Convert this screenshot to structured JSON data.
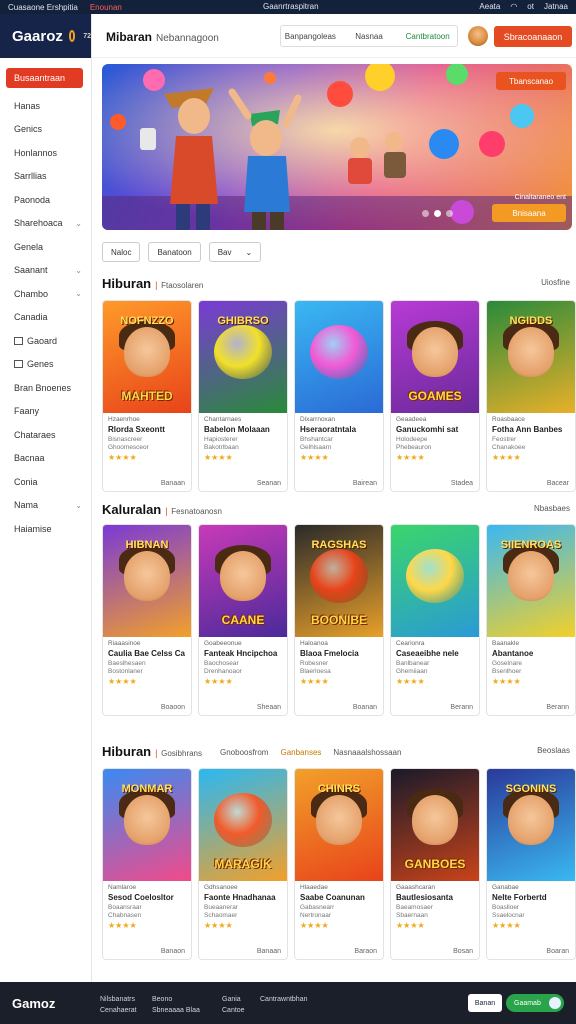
{
  "status_bar": {
    "left_1": "Cuasaone Ershpitia",
    "left_2": "Enounan",
    "center": "Gaanrtraspitran",
    "right_1": "Aeata",
    "right_2": "ot",
    "right_3": "Jatnaa"
  },
  "sidebar": {
    "logo": "Gaaroz",
    "logo_sup": "72",
    "cta": "Busaantraan",
    "items": [
      {
        "label": "Hanas",
        "chevron": false,
        "icon": false
      },
      {
        "label": "Genics",
        "chevron": false,
        "icon": false
      },
      {
        "label": "Honlannos",
        "chevron": false,
        "icon": false
      },
      {
        "label": "Sarrllias",
        "chevron": false,
        "icon": false
      },
      {
        "label": "Paonoda",
        "chevron": false,
        "icon": false
      },
      {
        "label": "Sharehoaca",
        "chevron": true,
        "icon": false
      },
      {
        "label": "Genela",
        "chevron": false,
        "icon": false
      },
      {
        "label": "Saanant",
        "chevron": true,
        "icon": false
      },
      {
        "label": "Chambo",
        "chevron": true,
        "icon": false
      },
      {
        "label": "Canadia",
        "chevron": false,
        "icon": false
      },
      {
        "label": "Gaoard",
        "chevron": false,
        "icon": true
      },
      {
        "label": "Genes",
        "chevron": false,
        "icon": true
      },
      {
        "label": "Bran Bnoenes",
        "chevron": false,
        "icon": false
      },
      {
        "label": "Faany",
        "chevron": false,
        "icon": false
      },
      {
        "label": "Chataraes",
        "chevron": false,
        "icon": false
      },
      {
        "label": "Bacnaa",
        "chevron": false,
        "icon": false
      },
      {
        "label": "Conia",
        "chevron": false,
        "icon": false
      },
      {
        "label": "Nama",
        "chevron": true,
        "icon": false
      },
      {
        "label": "Haiamise",
        "chevron": false,
        "icon": false
      }
    ]
  },
  "header": {
    "title": "Mibaran",
    "subtitle": "Nebannagoon",
    "tabs": [
      "Banpangoleas",
      "Nasnaa",
      "Cantbratoon"
    ],
    "active_tab_index": 2,
    "cta": "Sbracoanaaon"
  },
  "hero": {
    "cta": "Tbanscanao",
    "caption": "Cinaltaraneo ent",
    "button": "Bnisaana"
  },
  "filters": [
    "Naloc",
    "Banatoon",
    "Bav"
  ],
  "sections": [
    {
      "title": "Hiburan",
      "subtitle": "Ftaosolaren",
      "link": "Uiosfine",
      "tabs": [],
      "cards": [
        {
          "thumb_text": "MAHTED",
          "thumb_top": "NOFNZZO",
          "l1": "Hzaenrhoe",
          "l2": "Rlorda Sxeontt",
          "l3": "Bisnascreer",
          "l4": "Ghoomesceor",
          "stars": "★★★★",
          "more": "Banaan"
        },
        {
          "thumb_text": "",
          "thumb_top": "GHIBRSO",
          "l1": "Chantarnaes",
          "l2": "Babelon Molaaan",
          "l3": "Hapiosterer",
          "l4": "Bakotrlbaan",
          "stars": "★★★★",
          "more": "Seanan"
        },
        {
          "thumb_text": "",
          "thumb_top": "",
          "l1": "Dixarrnoxan",
          "l2": "Hseraoratntala",
          "l3": "Bhshantcar",
          "l4": "Gelhlsaarn",
          "stars": "★★★★",
          "more": "Bairean"
        },
        {
          "thumb_text": "GOAMES",
          "thumb_top": "",
          "l1": "Geaadeea",
          "l2": "Ganuckomhi sat",
          "l3": "Holodeepe",
          "l4": "Phebeauron",
          "stars": "★★★★",
          "more": "Stadea"
        },
        {
          "thumb_text": "",
          "thumb_top": "NGIDDS",
          "l1": "Roasbaace",
          "l2": "Fotha Ann Banbes",
          "l3": "Feostrer",
          "l4": "Chanakoee",
          "stars": "★★★★",
          "more": "Bacear"
        }
      ]
    },
    {
      "title": "Kaluralan",
      "subtitle": "Fesnatoanosn",
      "link": "Nbasbaes",
      "tabs": [],
      "cards": [
        {
          "thumb_text": "",
          "thumb_top": "HIBNAN",
          "l1": "Riaaasinoe",
          "l2": "Caulia Bae Celss Ca",
          "l3": "Baeslhesaen",
          "l4": "Bostonlaner",
          "stars": "★★★★",
          "more": "Boaoon"
        },
        {
          "thumb_text": "CAANE",
          "thumb_top": "",
          "l1": "Goabeeonue",
          "l2": "Fanteak Hncipchoa",
          "l3": "Baochosear",
          "l4": "Drenhanoaor",
          "stars": "★★★★",
          "more": "Sheaan"
        },
        {
          "thumb_text": "BOONIBE",
          "thumb_top": "RAGSHAS",
          "l1": "Haloanoa",
          "l2": "Blaoa Fmelocia",
          "l3": "Robesner",
          "l4": "Blaerloesa",
          "stars": "★★★★",
          "more": "Boanan"
        },
        {
          "thumb_text": "",
          "thumb_top": "",
          "l1": "Cearionra",
          "l2": "Caseaeibhe nele",
          "l3": "Banlbanear",
          "l4": "Ghemiiaan",
          "stars": "★★★★",
          "more": "Berann"
        },
        {
          "thumb_text": "",
          "thumb_top": "SIIENROAS",
          "l1": "Baanakle",
          "l2": "Abantanoe",
          "l3": "Goselnare",
          "l4": "Bsenlhoer",
          "stars": "★★★★",
          "more": "Berann"
        }
      ]
    },
    {
      "title": "Hiburan",
      "subtitle": "Gosibhrans",
      "link": "Beoslaas",
      "tabs": [
        "Gnoboosfrom",
        "Ganbanses",
        "Nasnaaalshossaan"
      ],
      "cards": [
        {
          "thumb_text": "",
          "thumb_top": "MONMAR",
          "l1": "Namlaroe",
          "l2": "Sesod Coelosltor",
          "l3": "Boaansraar",
          "l4": "Chabnasen",
          "stars": "★★★★",
          "more": "Banaon"
        },
        {
          "thumb_text": "MARAGIK",
          "thumb_top": "",
          "l1": "Gdhsanoee",
          "l2": "Faonte Hnadhanaa",
          "l3": "Bueaanerar",
          "l4": "Schaomaer",
          "stars": "★★★★",
          "more": "Banaan"
        },
        {
          "thumb_text": "",
          "thumb_top": "CHINRS",
          "l1": "Hlaaedae",
          "l2": "Saabe Coanunan",
          "l3": "Gabasnearr",
          "l4": "Nertronaar",
          "stars": "★★★★",
          "more": "Baraon"
        },
        {
          "thumb_text": "GANBOES",
          "thumb_top": "",
          "l1": "Gaaashcaran",
          "l2": "Bautlesiosanta",
          "l3": "Baeamosaer",
          "l4": "Sbaernaan",
          "stars": "★★★★",
          "more": "Bosan"
        },
        {
          "thumb_text": "",
          "thumb_top": "SGONINS",
          "l1": "Ganabae",
          "l2": "Nelte Forbertd",
          "l3": "Boaslloer",
          "l4": "Ssaelocnar",
          "stars": "★★★★",
          "more": "Boaran"
        }
      ]
    }
  ],
  "footer": {
    "logo": "Gamoz",
    "col1": [
      "Nilsbanatrs",
      "Cenahaerat"
    ],
    "col2": [
      "Beono",
      "Sbneaaaa Blaa"
    ],
    "col3": [
      "Gania",
      "Cantoe"
    ],
    "col4": [
      "Cantrawntbhan"
    ],
    "btn1": "Banan",
    "btn2": "Gaamab"
  },
  "colors": {
    "accent": "#e54b22",
    "sidebar_logo_bg": "#16244a",
    "footer_bg": "#1b1f2a",
    "active_tab": "#1e8a3a",
    "stars": "#f0a81a"
  }
}
